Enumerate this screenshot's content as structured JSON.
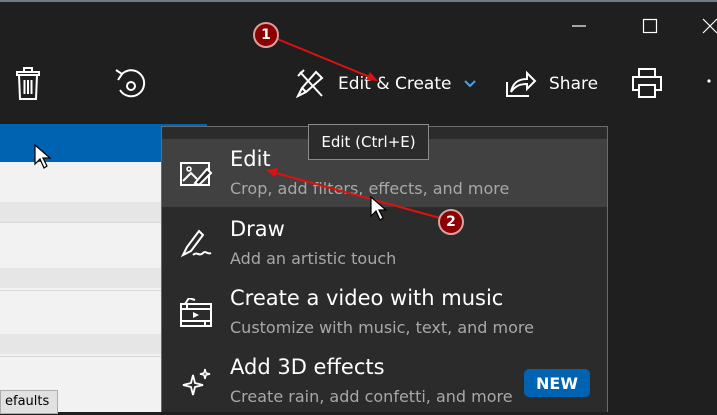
{
  "toolbar": {
    "edit_create_label": "Edit & Create",
    "share_label": "Share"
  },
  "tooltip": {
    "text": "Edit (Ctrl+E)"
  },
  "menu": {
    "items": [
      {
        "title": "Edit",
        "subtitle": "Crop, add filters, effects, and more",
        "icon": "edit-image-icon"
      },
      {
        "title": "Draw",
        "subtitle": "Add an artistic touch",
        "icon": "pen-icon"
      },
      {
        "title": "Create a video with music",
        "subtitle": "Customize with music, text, and more",
        "icon": "video-icon"
      },
      {
        "title": "Add 3D effects",
        "subtitle": "Create rain, add confetti, and more",
        "icon": "sparkle-icon",
        "badge": "NEW"
      }
    ]
  },
  "background_panel": {
    "defaults_label": "efaults"
  },
  "annotations": {
    "marker_1": "1",
    "marker_2": "2"
  },
  "colors": {
    "accent": "#0063b1",
    "annotation": "#8b0000",
    "chevron": "#4aa3e8"
  }
}
